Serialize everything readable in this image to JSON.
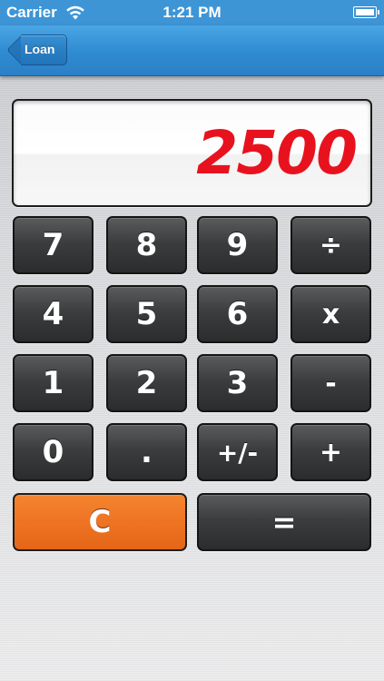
{
  "status_bar": {
    "carrier": "Carrier",
    "time": "1:21 PM",
    "wifi_icon": "wifi-icon",
    "battery_icon": "battery-icon"
  },
  "nav_bar": {
    "back_label": "Loan"
  },
  "display": {
    "value": "2500",
    "color": "#e8121e"
  },
  "keys": {
    "k7": "7",
    "k8": "8",
    "k9": "9",
    "divide": "÷",
    "k4": "4",
    "k5": "5",
    "k6": "6",
    "multiply": "x",
    "k1": "1",
    "k2": "2",
    "k3": "3",
    "subtract": "-",
    "k0": "0",
    "decimal": ".",
    "negate": "+/-",
    "add": "+",
    "clear": "C",
    "equals": "="
  },
  "colors": {
    "nav_blue": "#2f8bd1",
    "clear_orange": "#ef7525",
    "key_dark": "#3b3d3e"
  }
}
